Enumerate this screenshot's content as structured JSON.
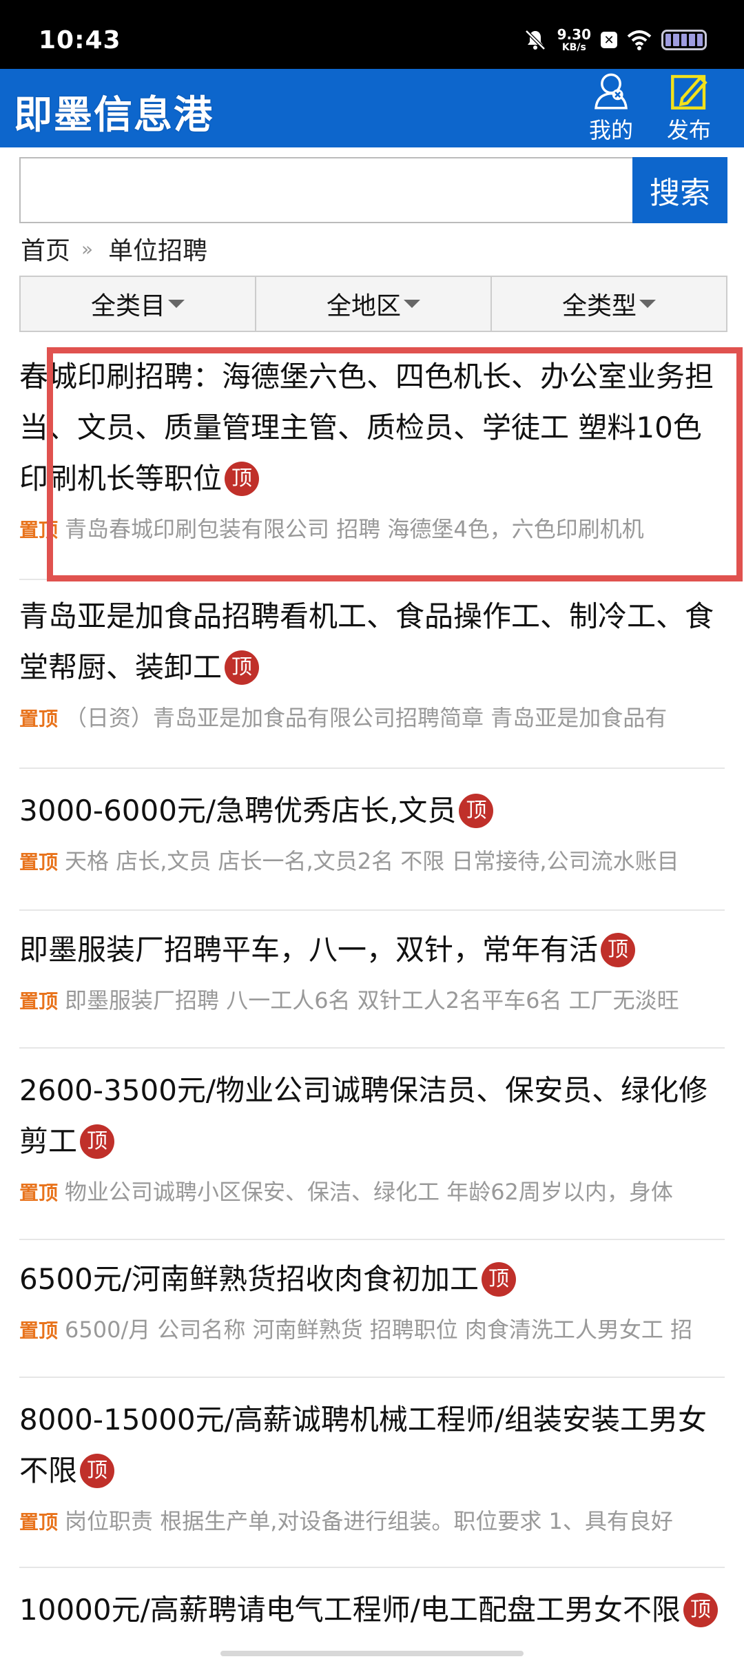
{
  "status_bar": {
    "time": "10:43",
    "net_speed": "9.30",
    "net_unit": "KB/s",
    "x_badge": "✕"
  },
  "header": {
    "app_title": "即墨信息港",
    "mine_label": "我的",
    "publish_label": "发布",
    "color": "#0d66cc"
  },
  "search": {
    "value": "",
    "placeholder": "",
    "button_label": "搜索"
  },
  "breadcrumb": {
    "home": "首页",
    "separator": "»",
    "current": "单位招聘"
  },
  "filters": [
    {
      "label": "全类目"
    },
    {
      "label": "全地区"
    },
    {
      "label": "全类型"
    }
  ],
  "posts": [
    {
      "title": "春城印刷招聘：海德堡六色、四色机长、办公室业务担当、文员、质量管理主管、质检员、学徒工 塑料10色印刷机长等职位",
      "badge": "顶",
      "pin": "置顶",
      "summary": "青岛春城印刷包装有限公司 招聘 海德堡4色，六色印刷机机"
    },
    {
      "title": "青岛亚是加食品招聘看机工、食品操作工、制冷工、食堂帮厨、装卸工",
      "badge": "顶",
      "pin": "置顶",
      "summary": "（日资）青岛亚是加食品有限公司招聘简章 青岛亚是加食品有"
    },
    {
      "title": "3000-6000元/急聘优秀店长,文员",
      "badge": "顶",
      "pin": "置顶",
      "summary": "天格 店长,文员 店长一名,文员2名 不限 日常接待,公司流水账目"
    },
    {
      "title": "即墨服装厂招聘平车，八一，双针，常年有活",
      "badge": "顶",
      "pin": "置顶",
      "summary": "即墨服装厂招聘 八一工人6名 双针工人2名平车6名 工厂无淡旺"
    },
    {
      "title": "2600-3500元/物业公司诚聘保洁员、保安员、绿化修剪工",
      "badge": "顶",
      "pin": "置顶",
      "summary": "物业公司诚聘小区保安、保洁、绿化工 年龄62周岁以内，身体"
    },
    {
      "title": "6500元/河南鲜熟货招收肉食初加工",
      "badge": "顶",
      "pin": "置顶",
      "summary": "6500/月 公司名称 河南鲜熟货 招聘职位 肉食清洗工人男女工 招"
    },
    {
      "title": "8000-15000元/高薪诚聘机械工程师/组装安装工男女不限",
      "badge": "顶",
      "pin": "置顶",
      "summary": "岗位职责 根据生产单,对设备进行组装。职位要求 1、具有良好"
    },
    {
      "title": "10000元/高薪聘请电气工程师/电工配盘工男女不限",
      "badge": "顶",
      "pin": "",
      "summary": ""
    }
  ],
  "colors": {
    "badge": "#c0302a",
    "pin": "#e8731c",
    "highlight": "#e0524f"
  }
}
